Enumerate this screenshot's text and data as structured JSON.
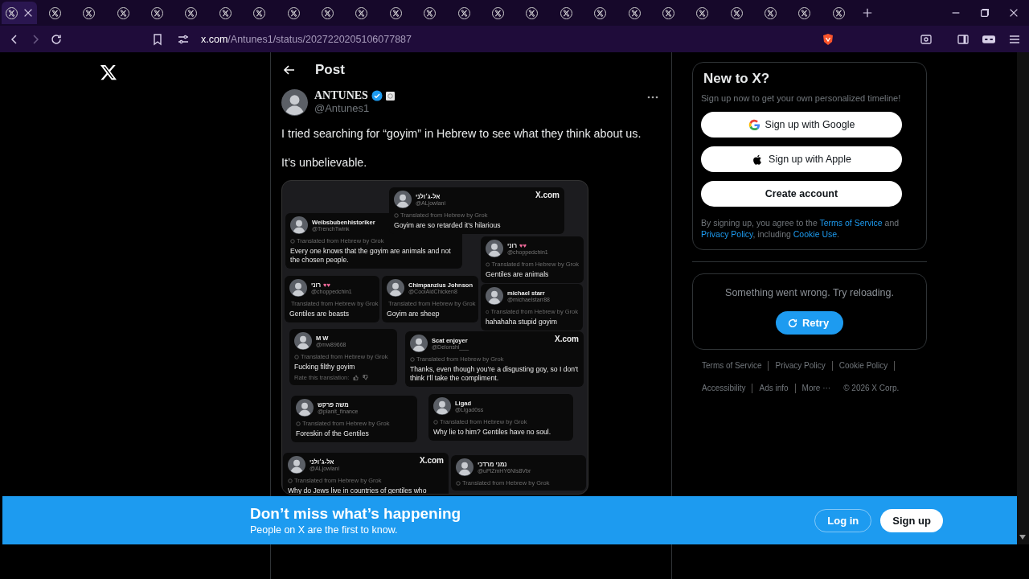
{
  "browser": {
    "tabs": [
      {
        "selected": true
      },
      {
        "selected": false
      },
      {
        "selected": false
      },
      {
        "selected": false
      },
      {
        "selected": false
      },
      {
        "selected": false
      },
      {
        "selected": false
      },
      {
        "selected": false
      },
      {
        "selected": false
      },
      {
        "selected": false
      },
      {
        "selected": false
      },
      {
        "selected": false
      },
      {
        "selected": false
      },
      {
        "selected": false
      },
      {
        "selected": false
      },
      {
        "selected": false
      },
      {
        "selected": false
      },
      {
        "selected": false
      },
      {
        "selected": false
      },
      {
        "selected": false
      },
      {
        "selected": false
      },
      {
        "selected": false
      },
      {
        "selected": false
      },
      {
        "selected": false
      },
      {
        "selected": false
      }
    ],
    "forward_disabled": true,
    "url_host": "x.com",
    "url_path": "/Antunes1/status/2027220205106077887"
  },
  "post": {
    "title": "Post",
    "author": {
      "name": "ANTUNES",
      "verified": true,
      "handle": "@Antunes1"
    },
    "paragraphs": [
      "I tried searching for “goyim” in Hebrew to see what they think about us.",
      "It’s unbelievable."
    ],
    "media": {
      "posts": [
        {
          "name": "אל-ג׳ולני",
          "handle": "@ALjowlani",
          "note": "Translated from Hebrew by Grok",
          "text": "Goyim are so retarded it's hilarious",
          "site": "X.com"
        },
        {
          "name": "Weibsbubenhistoriker",
          "handle": "@TrenchTwink",
          "note": "Translated from Hebrew by Grok",
          "text": "Every one knows that the goyim are animals and not the chosen people."
        },
        {
          "name": "רוני",
          "emoji": "♥♥",
          "handle": "@choppedchin1",
          "note": "Translated from Hebrew by Grok",
          "text": "Gentiles are animals"
        },
        {
          "name": "רוני",
          "emoji": "♥♥",
          "handle": "@choppedchin1",
          "note": "Translated from Hebrew by Grok",
          "text": "Gentiles are beasts"
        },
        {
          "name": "Chimpanzius Johnson",
          "handle": "@CoolAidChicken8",
          "note": "Translated from Hebrew by Grok",
          "text": "Goyim are sheep"
        },
        {
          "name": "michael starr",
          "handle": "@michaelstarr88",
          "note": "Translated from Hebrew by Grok",
          "text": "hahahaha stupid goyim"
        },
        {
          "name": "M W",
          "handle": "@mw89668",
          "note": "Translated from Hebrew by Grok",
          "text": "Fucking filthy goyim",
          "rating": "Rate this translation:"
        },
        {
          "name": "Scat enjoyer",
          "handle": "@Delonshi___",
          "note": "Translated from Hebrew by Grok",
          "text": "Thanks, even though you're a disgusting goy, so I don't think I'll take the compliment.",
          "site": "X.com"
        },
        {
          "name": "משה פרקש",
          "handle": "@planit_finance",
          "note": "Translated from Hebrew by Grok",
          "text": "Foreskin of the Gentiles"
        },
        {
          "name": "Ligad",
          "handle": "@Ligad0ss",
          "note": "Translated from Hebrew by Grok",
          "text": "Why lie to him? Gentiles have no soul."
        },
        {
          "name": "אל-ג׳ולני",
          "handle": "@ALjowlani",
          "note": "Translated from Hebrew by Grok",
          "text": "Why do Jews live in countries of gentiles who",
          "site": "X.com"
        },
        {
          "name": "נמני מרדכי",
          "handle": "@uPlZmHY6NIs8Vbr",
          "note": "Translated from Hebrew by Grok"
        }
      ]
    }
  },
  "sidebar": {
    "signup": {
      "title": "New to X?",
      "subtitle": "Sign up now to get your own personalized timeline!",
      "buttons": [
        {
          "kind": "google",
          "label": "Sign up with Google"
        },
        {
          "kind": "apple",
          "label": "Sign up with Apple"
        },
        {
          "kind": "plain",
          "label": "Create account"
        }
      ],
      "legal": [
        {
          "kind": "text",
          "text": "By signing up, you agree to the "
        },
        {
          "kind": "link",
          "text": "Terms of Service"
        },
        {
          "kind": "text",
          "text": " and "
        },
        {
          "kind": "link",
          "text": "Privacy Policy"
        },
        {
          "kind": "text",
          "text": ", including "
        },
        {
          "kind": "link",
          "text": "Cookie Use"
        },
        {
          "kind": "text",
          "text": "."
        }
      ]
    },
    "error": {
      "message": "Something went wrong. Try reloading.",
      "button": "Retry"
    },
    "footer": [
      "Terms of Service",
      "Privacy Policy",
      "Cookie Policy",
      "Accessibility",
      "Ads info",
      "More ···",
      "© 2026 X Corp."
    ]
  },
  "banner": {
    "title": "Don’t miss what’s happening",
    "subtitle": "People on X are the first to know.",
    "login": "Log in",
    "signup": "Sign up"
  }
}
